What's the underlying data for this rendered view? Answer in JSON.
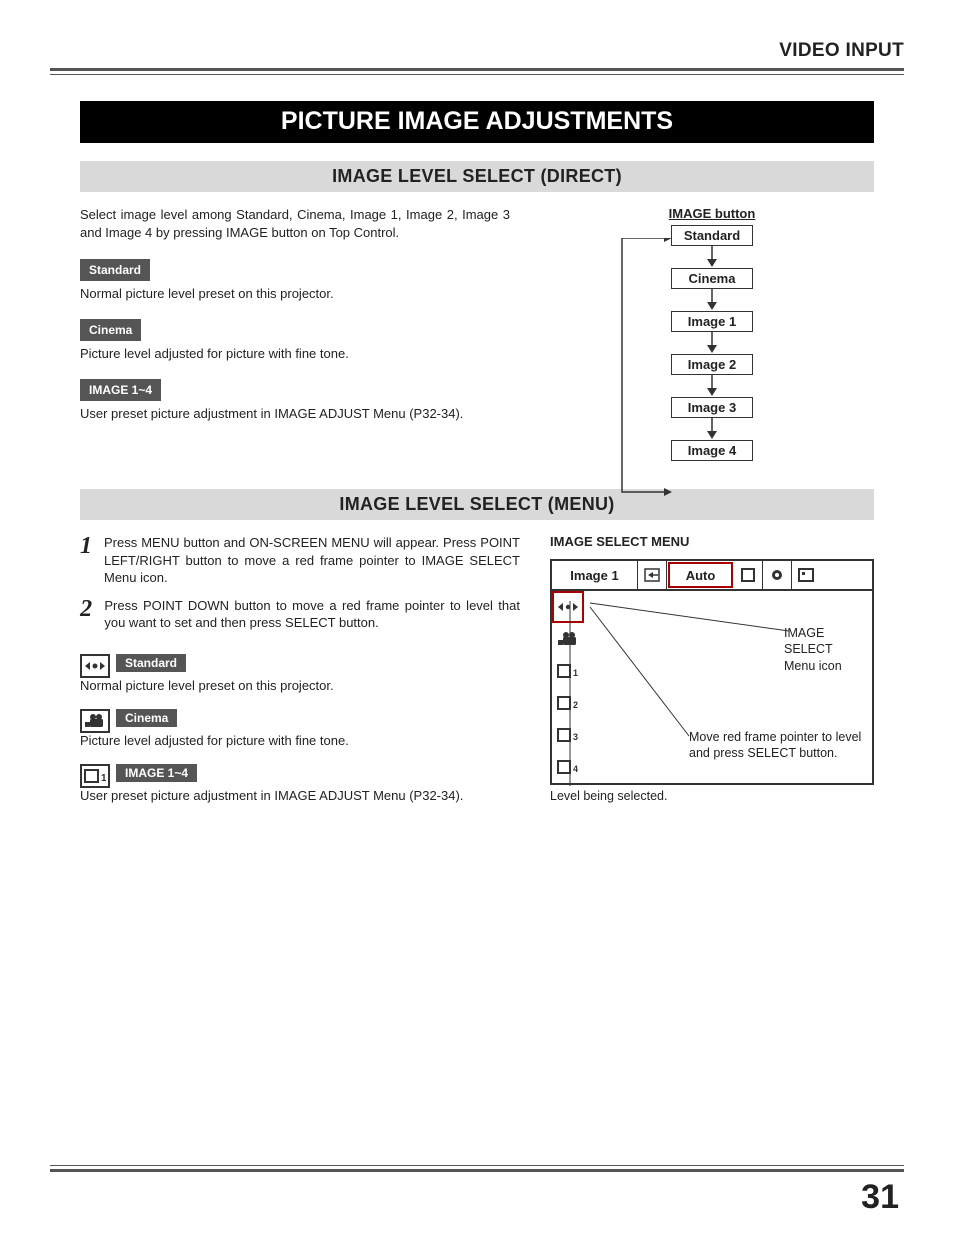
{
  "header": {
    "section": "VIDEO INPUT"
  },
  "title": "PICTURE IMAGE ADJUSTMENTS",
  "direct": {
    "heading": "IMAGE LEVEL SELECT (DIRECT)",
    "intro": "Select image level among Standard, Cinema, Image 1, Image 2, Image 3 and Image 4 by pressing IMAGE button on Top Control.",
    "items": [
      {
        "label": "Standard",
        "desc": "Normal picture level preset on this projector."
      },
      {
        "label": "Cinema",
        "desc": "Picture level adjusted for picture with fine tone."
      },
      {
        "label": "IMAGE 1~4",
        "desc": "User preset picture adjustment in IMAGE ADJUST Menu (P32-34)."
      }
    ],
    "flow": {
      "button_label": "IMAGE button",
      "levels": [
        "Standard",
        "Cinema",
        "Image 1",
        "Image 2",
        "Image 3",
        "Image 4"
      ]
    }
  },
  "menu": {
    "heading": "IMAGE LEVEL SELECT (MENU)",
    "steps": [
      {
        "n": "1",
        "text": "Press MENU button and ON-SCREEN MENU will appear.  Press POINT LEFT/RIGHT button to move a red frame pointer to IMAGE SELECT Menu icon."
      },
      {
        "n": "2",
        "text": "Press POINT DOWN button to move a red frame pointer to level that you want to set and then press SELECT button."
      }
    ],
    "items": [
      {
        "icon": "standard-icon",
        "label": "Standard",
        "desc": "Normal picture level preset on this projector."
      },
      {
        "icon": "cinema-icon",
        "label": "Cinema",
        "desc": "Picture level adjusted for picture with fine tone."
      },
      {
        "icon": "image1-icon",
        "label": "IMAGE 1~4",
        "desc": "User preset picture adjustment in IMAGE ADJUST Menu (P32-34)."
      }
    ],
    "osd": {
      "heading": "IMAGE SELECT MENU",
      "current": "Image 1",
      "mode": "Auto",
      "icon_label_line1": "IMAGE SELECT",
      "icon_label_line2": "Menu icon",
      "pointer_line1": "Move red frame pointer to level",
      "pointer_line2": "and press SELECT button.",
      "selected_caption": "Level being selected."
    }
  },
  "page_number": "31"
}
